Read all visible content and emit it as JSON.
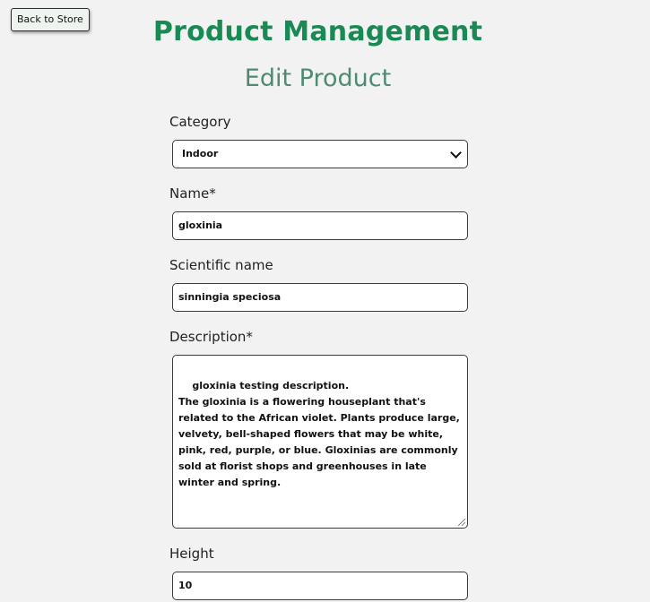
{
  "nav": {
    "back_label": "Back to Store"
  },
  "header": {
    "title": "Product Management",
    "subtitle": "Edit Product"
  },
  "form": {
    "category": {
      "label": "Category",
      "value": "Indoor"
    },
    "name": {
      "label": "Name*",
      "value": "gloxinia"
    },
    "scientific_name": {
      "label": "Scientific name",
      "value": "sinningia speciosa"
    },
    "description": {
      "label": "Description*",
      "value": "gloxinia testing description.\nThe gloxinia is a flowering houseplant that's related to the African violet. Plants produce large, velvety, bell-shaped flowers that may be white, pink, red, purple, or blue. Gloxinias are commonly sold at florist shops and greenhouses in late winter and spring."
    },
    "height": {
      "label": "Height",
      "value": "10"
    }
  },
  "colors": {
    "background": "#f2f2f2",
    "title": "#1a8a55",
    "subtitle": "#4f8a72"
  }
}
